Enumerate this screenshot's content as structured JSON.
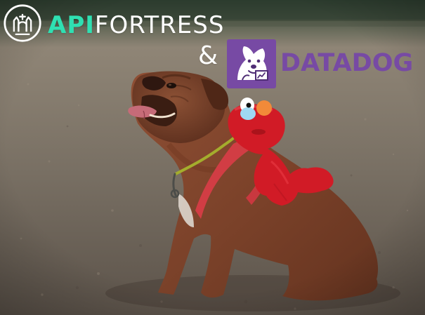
{
  "logos": {
    "apifortress": {
      "emphasis": "API",
      "rest": "FORTRESS",
      "accent_color": "#2fe0b2"
    },
    "separator": "&",
    "datadog": {
      "text": "DATADOG",
      "brand_color": "#774aa4"
    }
  }
}
